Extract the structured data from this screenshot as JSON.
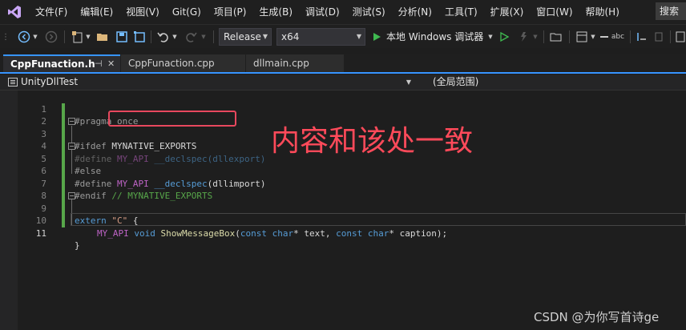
{
  "menubar": {
    "items": [
      "文件(F)",
      "编辑(E)",
      "视图(V)",
      "Git(G)",
      "项目(P)",
      "生成(B)",
      "调试(D)",
      "测试(S)",
      "分析(N)",
      "工具(T)",
      "扩展(X)",
      "窗口(W)",
      "帮助(H)"
    ],
    "search_label": "搜索"
  },
  "toolbar": {
    "config": "Release",
    "platform": "x64",
    "run_label": "本地 Windows 调试器"
  },
  "tabs": [
    {
      "label": "CppFunaction.h",
      "pin": "⊣"
    },
    {
      "label": "CppFunaction.cpp"
    },
    {
      "label": "dllmain.cpp"
    }
  ],
  "navbar": {
    "project": "UnityDllTest",
    "scope": "(全局范围)"
  },
  "editor": {
    "line_numbers": [
      "1",
      "2",
      "3",
      "4",
      "5",
      "6",
      "7",
      "8",
      "9",
      "10",
      "11"
    ],
    "code": {
      "l1": "#pragma once",
      "l3_pp": "#ifdef",
      "l3_macro": "MYNATIVE_EXPORTS",
      "l4_pp": "#define",
      "l4_macro": "MY_API",
      "l4_rest": "__declspec(dllexport)",
      "l5_pp": "#else",
      "l6_pp": "#define",
      "l6_macro": "MY_API",
      "l6_kw": "__declspec",
      "l6_rest": "(dllimport)",
      "l7_pp": "#endif",
      "l7_comment": "// MYNATIVE_EXPORTS",
      "l9_kw": "extern",
      "l9_str": "\"C\"",
      "l9_brace": "{",
      "l10_macro": "MY_API",
      "l10_void": "void",
      "l10_fn": "ShowMessageBox",
      "l10_p1": "(",
      "l10_const1": "const",
      "l10_char1": "char",
      "l10_p2": "* text, ",
      "l10_const2": "const",
      "l10_char2": "char",
      "l10_p3": "* caption);",
      "l11": "}"
    }
  },
  "annotation": "内容和该处一致",
  "watermark": "CSDN @为你写首诗ge",
  "colors": {
    "accent": "#3794ff",
    "annotation": "#ff4a5a",
    "change_bar": "#57a64a"
  }
}
